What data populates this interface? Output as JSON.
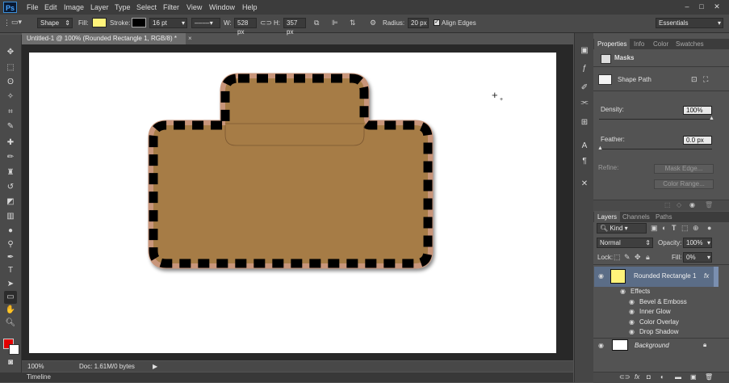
{
  "app": {
    "logo": "Ps"
  },
  "menu": [
    "File",
    "Edit",
    "Image",
    "Layer",
    "Type",
    "Select",
    "Filter",
    "View",
    "Window",
    "Help"
  ],
  "window_buttons": [
    "–",
    "□",
    "✕"
  ],
  "options": {
    "mode": "Shape",
    "fill_label": "Fill:",
    "stroke_label": "Stroke:",
    "stroke_width": "16 pt",
    "w_label": "W:",
    "w_value": "528 px",
    "h_label": "H:",
    "h_value": "357 px",
    "radius_label": "Radius:",
    "radius_value": "20 px",
    "align_edges": "Align Edges",
    "workspace": "Essentials",
    "fill_color": "#fff37a",
    "stroke_color": "#000000"
  },
  "document": {
    "tab_title": "Untitled-1 @ 100% (Rounded Rectangle 1, RGB/8) *",
    "close": "×"
  },
  "status": {
    "zoom": "100%",
    "doc": "Doc: 1.61M/0 bytes"
  },
  "timeline": {
    "label": "Timeline"
  },
  "shape": {
    "fill": "#a67c46",
    "stroke": "#000000",
    "accent": "#c8957a"
  },
  "properties": {
    "tabs": [
      "Properties",
      "Info",
      "Color",
      "Swatches"
    ],
    "section": "Masks",
    "shape_path": "Shape Path",
    "density_label": "Density:",
    "density_value": "100%",
    "feather_label": "Feather:",
    "feather_value": "0.0 px",
    "refine_label": "Refine:",
    "mask_edge": "Mask Edge...",
    "color_range": "Color Range..."
  },
  "layers": {
    "tabs": [
      "Layers",
      "Channels",
      "Paths"
    ],
    "kind": "Kind",
    "blend_mode": "Normal",
    "opacity_label": "Opacity:",
    "opacity_value": "100%",
    "lock_label": "Lock:",
    "fill_label": "Fill:",
    "fill_value": "0%",
    "items": [
      {
        "name": "Rounded Rectangle 1",
        "fx": "fx"
      },
      {
        "name": "Effects"
      },
      {
        "name": "Bevel & Emboss"
      },
      {
        "name": "Inner Glow"
      },
      {
        "name": "Color Overlay"
      },
      {
        "name": "Drop Shadow"
      },
      {
        "name": "Background"
      }
    ]
  }
}
